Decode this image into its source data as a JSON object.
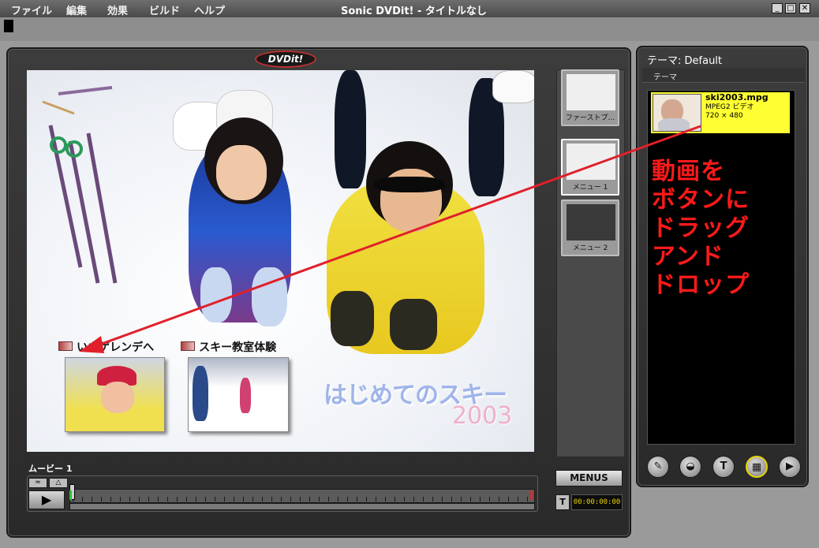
{
  "app": {
    "title": "Sonic DVDit! - タイトルなし"
  },
  "menubar": {
    "items": [
      "ファイル",
      "編集",
      "効果",
      "ビルド",
      "ヘルプ"
    ]
  },
  "window_controls": {
    "minimize": "_",
    "maximize": "□",
    "close": "✕"
  },
  "logo": {
    "text": "DVDit!"
  },
  "canvas": {
    "buttons": [
      {
        "label": "いざゲレンデへ"
      },
      {
        "label": "スキー教室体験"
      }
    ],
    "title_text": "はじめてのスキー",
    "year_text": "2003"
  },
  "side_thumbs": [
    {
      "label": "ファーストプ..."
    },
    {
      "label": "メニュー 1"
    },
    {
      "label": "メニュー 2"
    }
  ],
  "timeline": {
    "movie_label": "ムービー 1",
    "play_label": "▶",
    "menus_label": "MENUS",
    "t_label": "T",
    "timecode": "00:00:00:00"
  },
  "theme_panel": {
    "title": "テーマ: Default",
    "tab_label": "テーマ",
    "selected_item": {
      "filename": "ski2003.mpg",
      "type": "MPEG2 ビデオ",
      "resolution": "720 × 480"
    },
    "instruction_lines": [
      "動画を",
      "ボタンに",
      "ドラッグ",
      "アンド",
      "ドロップ"
    ],
    "bottom_buttons": [
      {
        "name": "brush",
        "glyph": "✎"
      },
      {
        "name": "button-style",
        "glyph": "◒"
      },
      {
        "name": "text",
        "glyph": "T"
      },
      {
        "name": "media",
        "glyph": "▦"
      },
      {
        "name": "next",
        "glyph": "▶"
      }
    ]
  },
  "colors": {
    "accent_yellow": "#ffff33",
    "instruction_red": "#ff1a1a",
    "arrow_red": "#e0202a"
  }
}
